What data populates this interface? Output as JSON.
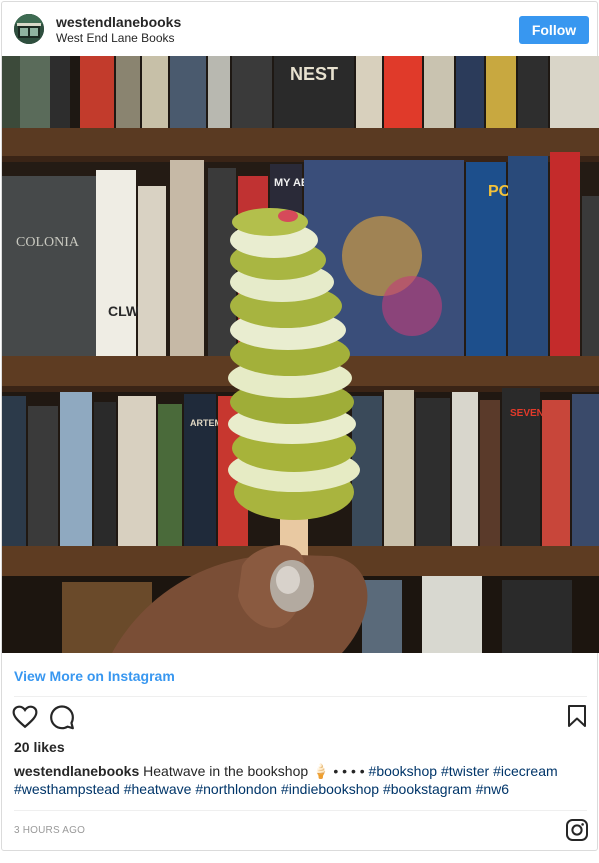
{
  "header": {
    "username": "westendlanebooks",
    "location": "West End Lane Books",
    "follow_label": "Follow",
    "avatar_icon": "bookshop-storefront-avatar"
  },
  "photo": {
    "subject": "hand holding a green and white twister ice lolly in front of bookshelves",
    "book_spines": [
      "NEST",
      "COLONIA",
      "CLW",
      "PONTI",
      "SEVENTEEN",
      "ARTEMIS",
      "MY AB"
    ]
  },
  "view_more_label": "View More on Instagram",
  "actions": {
    "like_icon": "heart-icon",
    "comment_icon": "comment-icon",
    "save_icon": "bookmark-icon"
  },
  "likes_text": "20 likes",
  "caption": {
    "username": "westendlanebooks",
    "text": " Heatwave in the bookshop 🍦 • • • • ",
    "tags": [
      "#bookshop",
      "#twister",
      "#icecream",
      "#westhampstead",
      "#heatwave",
      "#northlondon",
      "#indiebookshop",
      "#bookstagram",
      "#nw6"
    ]
  },
  "timestamp": "3 HOURS AGO",
  "footer_icon": "instagram-icon",
  "colors": {
    "accent": "#3897f0",
    "hashtag": "#003569",
    "muted": "#999999",
    "border": "#dbdbdb"
  }
}
